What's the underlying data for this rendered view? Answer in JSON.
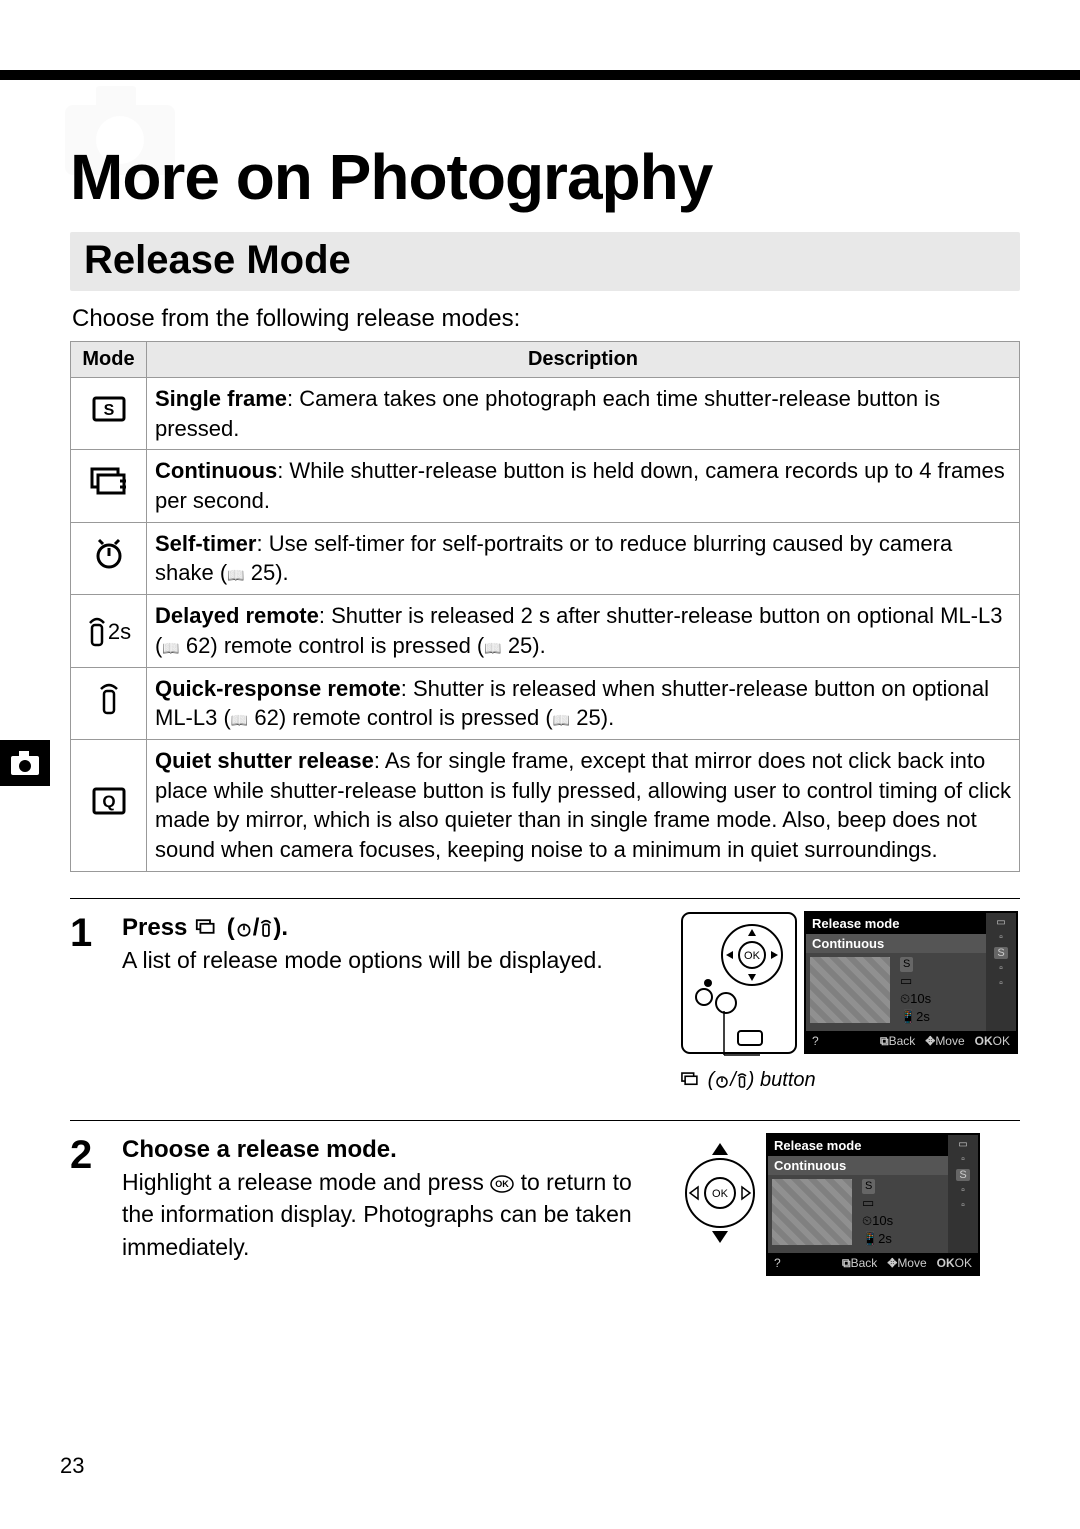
{
  "page_number": "23",
  "chapter_title": "More on Photography",
  "section_title": "Release Mode",
  "intro": "Choose from the following release modes:",
  "table": {
    "headers": {
      "mode": "Mode",
      "description": "Description"
    },
    "rows": [
      {
        "icon": "S",
        "term": "Single frame",
        "desc": ": Camera takes one photograph each time shutter-release button is pressed."
      },
      {
        "icon": "continuous",
        "term": "Continuous",
        "desc": ": While shutter-release button is held down, camera records up to 4 frames per second."
      },
      {
        "icon": "self-timer",
        "term": "Self-timer",
        "desc_prefix": ": Use self-timer for self-portraits or to reduce blurring caused by camera shake (",
        "ref1": "25",
        "desc_suffix": ")."
      },
      {
        "icon": "delayed-remote",
        "label": "2s",
        "term": "Delayed remote",
        "desc_prefix": ": Shutter is released 2 s after shutter-release button on optional ML-L3 (",
        "ref1": "62",
        "desc_mid": ") remote control is pressed (",
        "ref2": "25",
        "desc_suffix": ")."
      },
      {
        "icon": "quick-remote",
        "term": "Quick-response remote",
        "desc_prefix": ": Shutter is released when shutter-release button on optional ML-L3 (",
        "ref1": "62",
        "desc_mid": ") remote control is pressed (",
        "ref2": "25",
        "desc_suffix": ")."
      },
      {
        "icon": "Q",
        "term": "Quiet shutter release",
        "desc": ": As for single frame, except that mirror does not click back into place while shutter-release button is fully pressed, allowing user to control timing of click made by mirror, which is also quieter than in single frame mode. Also, beep does not sound when camera focuses, keeping noise to a minimum in quiet surroundings."
      }
    ]
  },
  "steps": [
    {
      "num": "1",
      "heading_prefix": "Press ",
      "heading_suffix": ".",
      "body": "A list of release mode options will be displayed.",
      "caption": " button"
    },
    {
      "num": "2",
      "heading": "Choose a release mode.",
      "body_prefix": "Highlight a release mode and press ",
      "body_suffix": " to return to the information display. Photographs can be taken immediately."
    }
  ],
  "lcd": {
    "title": "Release mode",
    "highlight": "Continuous",
    "items": [
      "S",
      "continuous",
      "10s",
      "2s"
    ],
    "selected_badge": "S",
    "foot_help": "?",
    "foot_back": "Back",
    "foot_move": "Move",
    "foot_ok": "OK"
  }
}
